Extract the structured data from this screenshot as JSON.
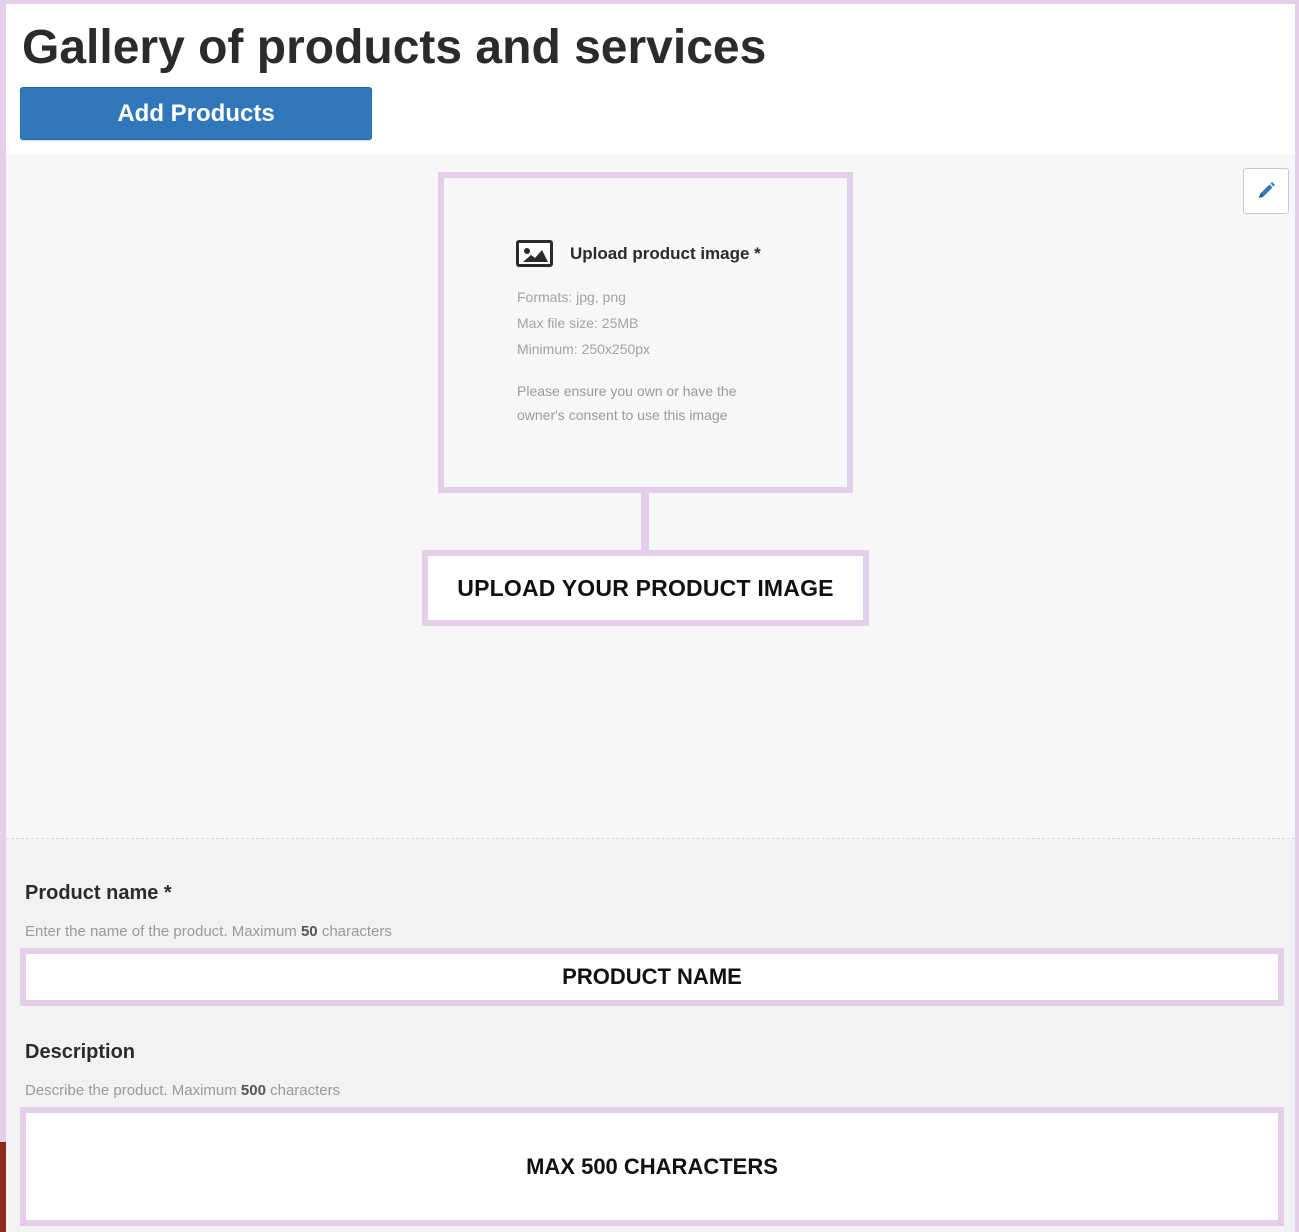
{
  "header": {
    "title": "Gallery of products and services",
    "add_button_label": "Add Products"
  },
  "upload": {
    "edit_icon": "pencil-icon",
    "image_icon": "image-icon",
    "title": "Upload product image *",
    "formats": "Formats: jpg, png",
    "max_size": "Max file size: 25MB",
    "minimum": "Minimum: 250x250px",
    "note": "Please ensure you own or have the owner's consent to use this image",
    "callout": "UPLOAD YOUR PRODUCT IMAGE"
  },
  "form": {
    "name_label": "Product name *",
    "name_help_prefix": "Enter the name of the product. Maximum ",
    "name_help_number": "50",
    "name_help_suffix": " characters",
    "name_value": "PRODUCT NAME",
    "description_label": "Description",
    "description_help_prefix": "Describe the product. Maximum ",
    "description_help_number": "500",
    "description_help_suffix": " characters",
    "description_value": "MAX 500 CHARACTERS"
  },
  "colors": {
    "accent_blue": "#3178bb",
    "highlight_border": "#e3cfe8"
  }
}
